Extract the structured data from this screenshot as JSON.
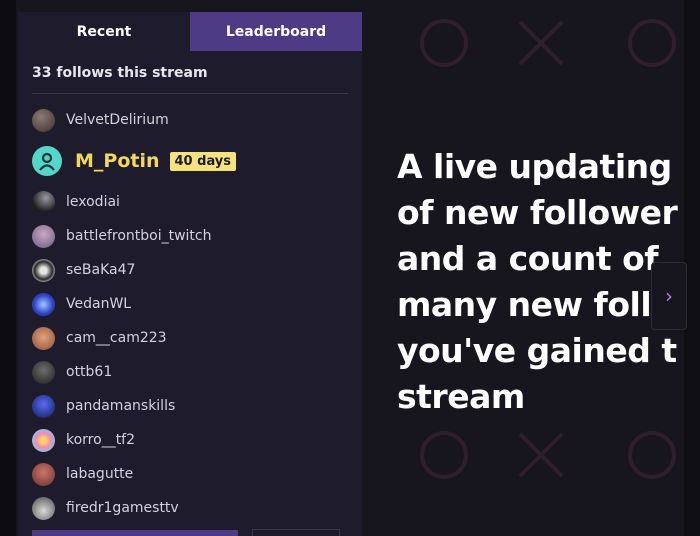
{
  "panel": {
    "tabs": [
      {
        "label": "Recent",
        "active": true
      },
      {
        "label": "Leaderboard",
        "active": false
      }
    ],
    "follow_count_text": "33 follows this stream",
    "featured_follower": {
      "name": "M_Potin",
      "badge": "40 days"
    },
    "followers": [
      {
        "name": "VelvetDelirium"
      },
      {
        "name": "lexodiai"
      },
      {
        "name": "battlefrontboi_twitch"
      },
      {
        "name": "seBaKa47"
      },
      {
        "name": "VedanWL"
      },
      {
        "name": "cam__cam223"
      },
      {
        "name": "ottb61"
      },
      {
        "name": "pandamanskills"
      },
      {
        "name": "korro__tf2"
      },
      {
        "name": "labagutte"
      },
      {
        "name": "firedr1gamesttv"
      }
    ]
  },
  "feature_text": "A live updating\nof new follower\nand a count of\nmany new foll\nyou've gained t\nstream",
  "next_icon": "chevron-right-icon",
  "colors": {
    "background": "#17151d",
    "panel": "#1e1b2c",
    "accent_purple": "#4d3b86",
    "featured_name": "#f3d85a",
    "badge": "#f6e27a",
    "arrow": "#a879ff"
  }
}
